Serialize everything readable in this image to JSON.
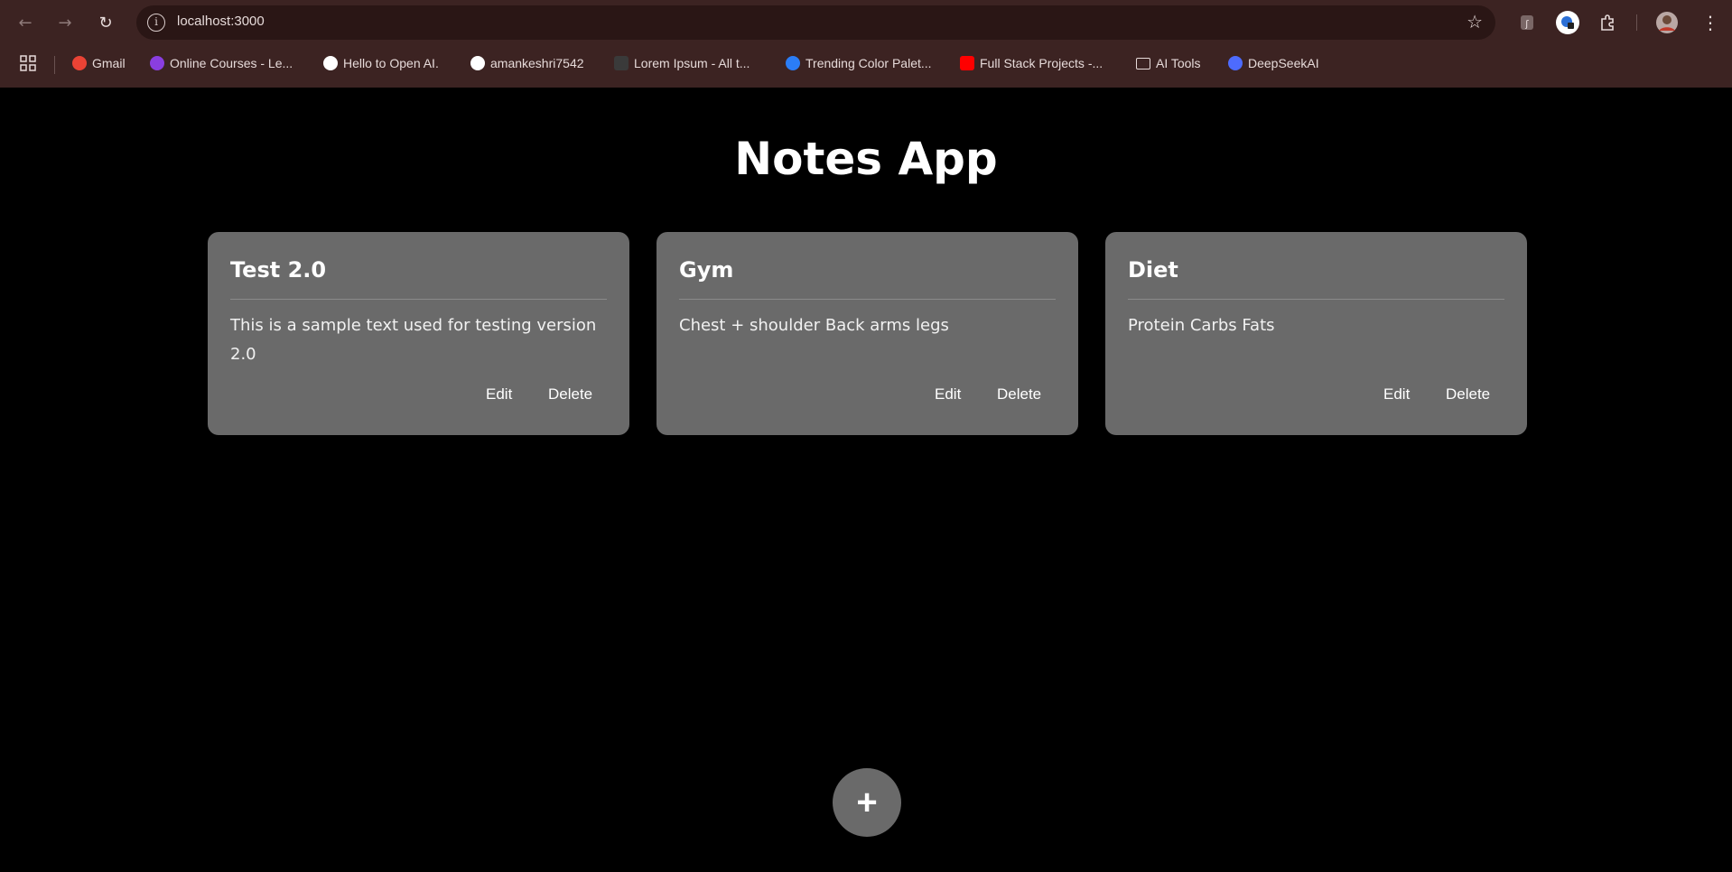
{
  "browser": {
    "url": "localhost:3000",
    "bookmarks": [
      {
        "label": "Gmail",
        "icon": "gmail-icon",
        "color": "#ea4335"
      },
      {
        "label": "Online Courses - Le...",
        "icon": "courses-icon",
        "color": "#8a3ee0"
      },
      {
        "label": "Hello to Open AI.",
        "icon": "openai-icon",
        "color": "#ffffff"
      },
      {
        "label": "amankeshri7542",
        "icon": "github-icon",
        "color": "#ffffff"
      },
      {
        "label": "Lorem Ipsum - All t...",
        "icon": "lorem-icon",
        "color": "#3a3a3a"
      },
      {
        "label": "Trending Color Palet...",
        "icon": "coolors-icon",
        "color": "#2b7df6"
      },
      {
        "label": "Full Stack Projects -...",
        "icon": "youtube-icon",
        "color": "#ff0000"
      },
      {
        "label": "AI Tools",
        "icon": "folder-icon",
        "color": "#e6dad9"
      },
      {
        "label": "DeepSeekAI",
        "icon": "deepseek-icon",
        "color": "#4d6bfe"
      }
    ]
  },
  "app": {
    "title": "Notes App",
    "notes": [
      {
        "title": "Test 2.0",
        "body": "This is a sample text used for testing version 2.0",
        "edit_label": "Edit",
        "delete_label": "Delete"
      },
      {
        "title": "Gym",
        "body": "Chest + shoulder Back arms legs",
        "edit_label": "Edit",
        "delete_label": "Delete"
      },
      {
        "title": "Diet",
        "body": "Protein Carbs Fats",
        "edit_label": "Edit",
        "delete_label": "Delete"
      }
    ],
    "add_label": "+"
  },
  "colors": {
    "page_bg": "#000000",
    "card_bg": "#6a6a6a",
    "browser_chrome": "#3c2322"
  }
}
